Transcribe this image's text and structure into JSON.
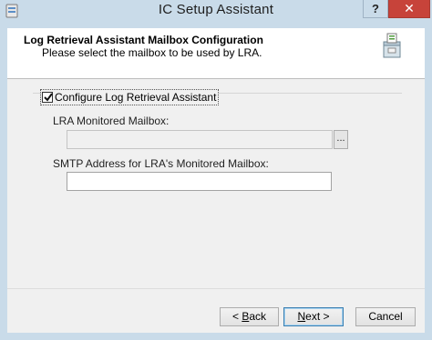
{
  "window": {
    "title": "IC Setup Assistant",
    "help_label": "?",
    "close_label": "✕",
    "icon": "app-icon"
  },
  "header": {
    "title": "Log Retrieval Assistant Mailbox Configuration",
    "subtitle": "Please select the mailbox to be used by LRA.",
    "icon": "setup-box-icon"
  },
  "form": {
    "configure_checkbox": {
      "label": "Configure Log Retrieval Assistant",
      "checked": true
    },
    "monitored_mailbox": {
      "label": "LRA Monitored Mailbox:",
      "value": "",
      "browse_label": "..."
    },
    "smtp_address": {
      "label": "SMTP Address for LRA's Monitored Mailbox:",
      "value": ""
    }
  },
  "footer": {
    "back": {
      "prefix": "< ",
      "mnemonic": "B",
      "rest": "ack"
    },
    "next": {
      "mnemonic": "N",
      "rest": "ext >"
    },
    "cancel_label": "Cancel"
  }
}
